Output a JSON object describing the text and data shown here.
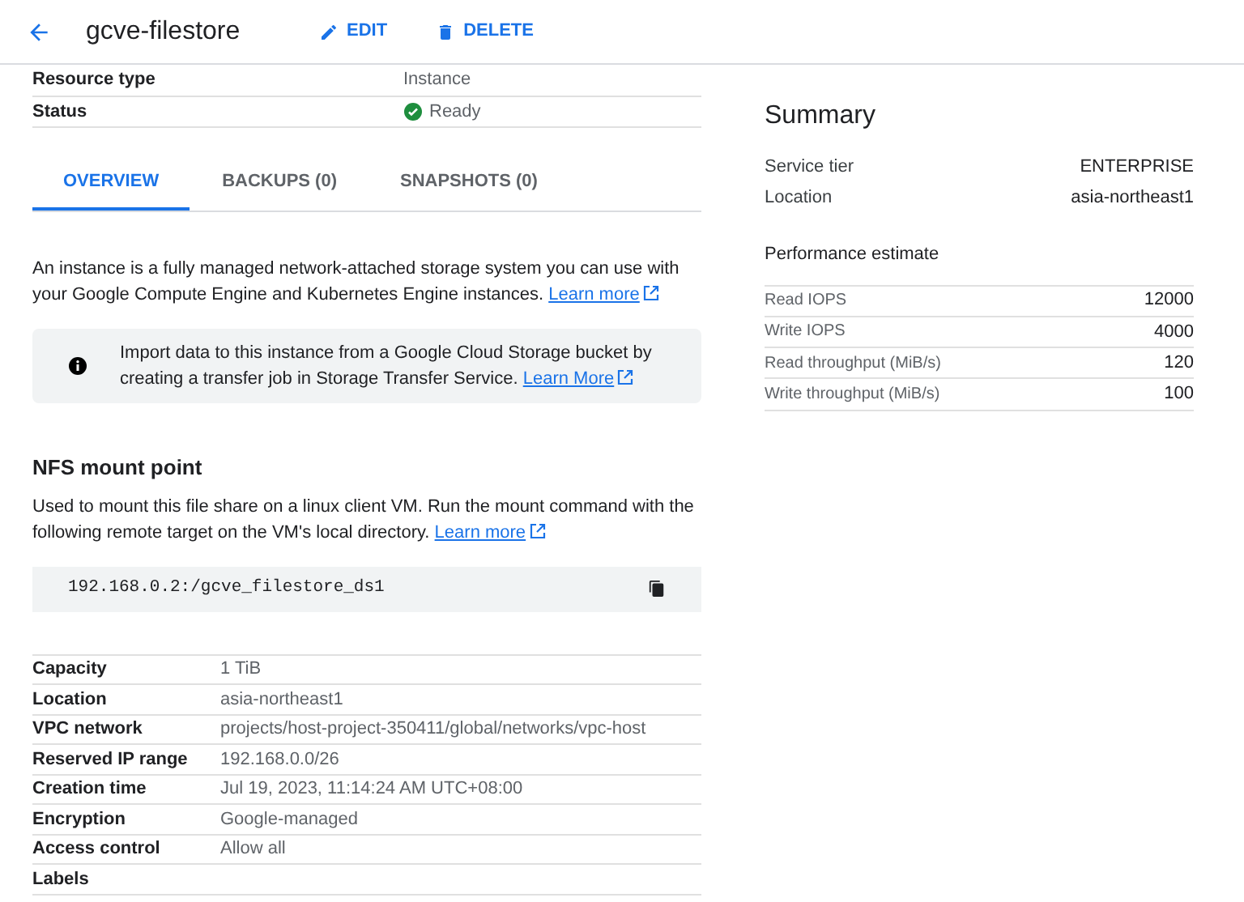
{
  "header": {
    "title": "gcve-filestore",
    "actions": [
      {
        "label": "EDIT",
        "kind": "edit"
      },
      {
        "label": "DELETE",
        "kind": "delete"
      }
    ]
  },
  "top_details": [
    {
      "label": "Resource type",
      "value": "Instance",
      "kind": "text"
    },
    {
      "label": "Status",
      "value": "Ready",
      "kind": "status"
    }
  ],
  "tabs": [
    {
      "label": "OVERVIEW",
      "selected": true
    },
    {
      "label": "BACKUPS (0)",
      "selected": false
    },
    {
      "label": "SNAPSHOTS (0)",
      "selected": false
    }
  ],
  "intro": {
    "text": "An instance is a fully managed network-attached storage system you can use with your Google Compute Engine and Kubernetes Engine instances.",
    "link": "Learn more"
  },
  "info_box": {
    "text": "Import data to this instance from a Google Cloud Storage bucket by creating a transfer job in Storage Transfer Service.",
    "link": "Learn More"
  },
  "nfs": {
    "heading": "NFS mount point",
    "text": "Used to mount this file share on a linux client VM. Run the mount command with the following remote target on the VM's local directory.",
    "link": "Learn more",
    "mount_target": "192.168.0.2:/gcve_filestore_ds1"
  },
  "details": [
    {
      "label": "Capacity",
      "value": "1 TiB"
    },
    {
      "label": "Location",
      "value": "asia-northeast1"
    },
    {
      "label": "VPC network",
      "value": "projects/host-project-350411/global/networks/vpc-host"
    },
    {
      "label": "Reserved IP range",
      "value": "192.168.0.0/26"
    },
    {
      "label": "Creation time",
      "value": "Jul 19, 2023, 11:14:24 AM UTC+08:00"
    },
    {
      "label": "Encryption",
      "value": "Google-managed"
    },
    {
      "label": "Access control",
      "value": "Allow all"
    },
    {
      "label": "Labels"
    }
  ],
  "summary": {
    "title": "Summary",
    "items": [
      {
        "label": "Service tier",
        "value": "ENTERPRISE"
      },
      {
        "label": "Location",
        "value": "asia-northeast1"
      }
    ],
    "performance_heading": "Performance estimate",
    "performance": [
      {
        "label": "Read IOPS",
        "value": "12000"
      },
      {
        "label": "Write IOPS",
        "value": "4000"
      },
      {
        "label": "Read throughput (MiB/s)",
        "value": "120"
      },
      {
        "label": "Write throughput (MiB/s)",
        "value": "100"
      }
    ]
  }
}
